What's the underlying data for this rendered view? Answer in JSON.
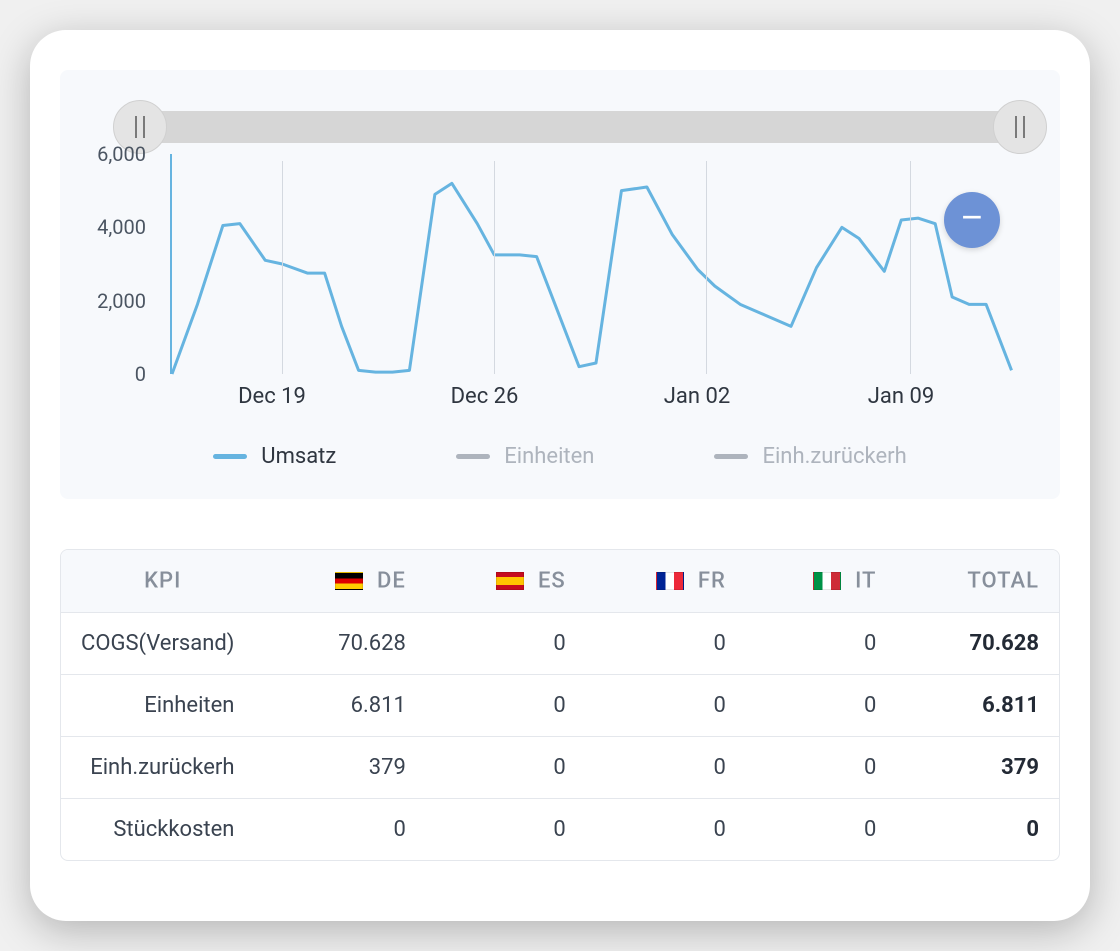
{
  "chart_data": {
    "type": "line",
    "title": "",
    "xlabel": "",
    "ylabel": "",
    "y_ticks": [
      "0",
      "2,000",
      "4,000",
      "6,000"
    ],
    "ylim": [
      0,
      6000
    ],
    "x_ticks": [
      "Dec 19",
      "Dec 26",
      "Jan 02",
      "Jan 09"
    ],
    "x_tick_positions_pct": [
      12,
      37,
      62,
      86
    ],
    "gridlines_pct": [
      13,
      38,
      63,
      87
    ],
    "series": [
      {
        "name": "Umsatz",
        "color": "#66b4e0",
        "active": true,
        "x_pct": [
          0,
          3,
          6,
          8,
          11,
          13,
          16,
          18,
          20,
          22,
          24,
          26,
          28,
          31,
          33,
          36,
          38,
          41,
          43,
          46,
          48,
          50,
          53,
          56,
          59,
          62,
          64,
          67,
          70,
          73,
          76,
          79,
          81,
          84,
          86,
          88,
          90,
          92,
          94,
          96,
          99
        ],
        "y_val": [
          0,
          1900,
          4050,
          4100,
          3100,
          3000,
          2750,
          2750,
          1300,
          100,
          50,
          50,
          100,
          4900,
          5200,
          4100,
          3250,
          3250,
          3200,
          1400,
          200,
          300,
          5000,
          5100,
          3800,
          2850,
          2400,
          1900,
          1600,
          1300,
          2900,
          4000,
          3700,
          2800,
          4200,
          4250,
          4100,
          2100,
          1900,
          1900,
          100
        ]
      },
      {
        "name": "Einheiten",
        "color": "#aeb4bd",
        "active": false
      },
      {
        "name": "Einh.zurückerh",
        "color": "#aeb4bd",
        "active": false
      }
    ],
    "fab_label": "–"
  },
  "table": {
    "headers": {
      "kpi": "KPI",
      "de": "DE",
      "es": "ES",
      "fr": "FR",
      "it": "IT",
      "total": "TOTAL"
    },
    "rows": [
      {
        "kpi": "COGS(Versand)",
        "de": "70.628",
        "es": "0",
        "fr": "0",
        "it": "0",
        "total": "70.628"
      },
      {
        "kpi": "Einheiten",
        "de": "6.811",
        "es": "0",
        "fr": "0",
        "it": "0",
        "total": "6.811"
      },
      {
        "kpi": "Einh.zurückerh",
        "de": "379",
        "es": "0",
        "fr": "0",
        "it": "0",
        "total": "379"
      },
      {
        "kpi": "Stückkosten",
        "de": "0",
        "es": "0",
        "fr": "0",
        "it": "0",
        "total": "0"
      }
    ]
  }
}
